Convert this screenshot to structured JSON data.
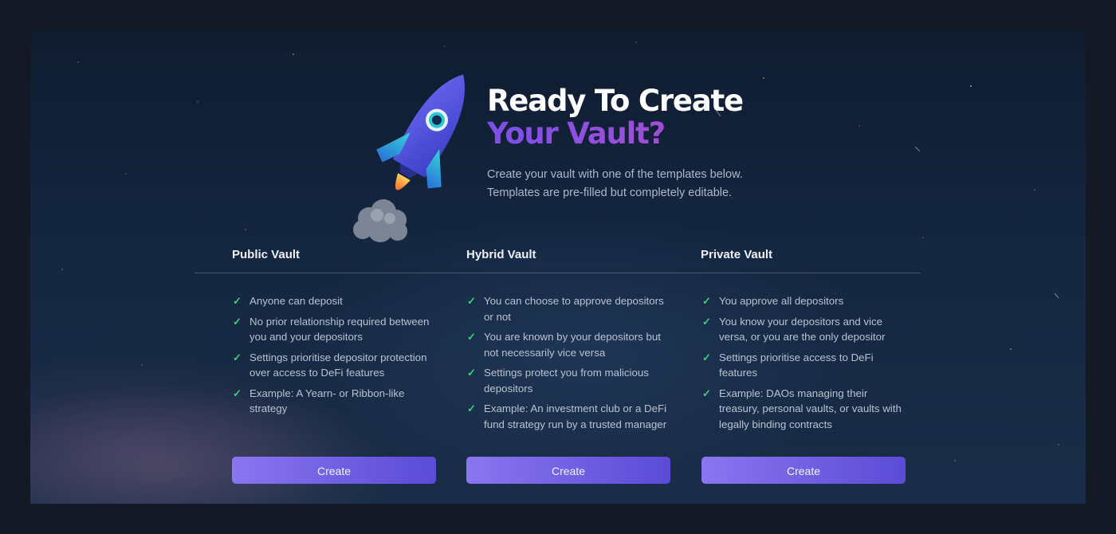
{
  "hero": {
    "title_line1": "Ready To Create",
    "title_line2": "Your Vault?",
    "subtitle_line1": "Create your vault with one of the templates below.",
    "subtitle_line2": "Templates are pre-filled but completely editable."
  },
  "icons": {
    "hero": "rocket-icon",
    "feature": "check-icon"
  },
  "colors": {
    "accent_purple": "#7b4fe8",
    "accent_pink": "#c34fc2",
    "check_green": "#3fd07a",
    "button_start": "#8a76f0",
    "button_end": "#5b4bd6"
  },
  "templates": [
    {
      "name": "Public Vault",
      "features": [
        "Anyone can deposit",
        "No prior relationship required between you and your depositors",
        "Settings prioritise depositor protection over access to DeFi features",
        "Example: A Yearn- or Ribbon-like strategy"
      ],
      "button_label": "Create"
    },
    {
      "name": "Hybrid Vault",
      "features": [
        "You can choose to approve depositors or not",
        "You are known by your depositors but not necessarily vice versa",
        "Settings protect you from malicious depositors",
        "Example: An investment club or a DeFi fund strategy run by a trusted manager"
      ],
      "button_label": "Create"
    },
    {
      "name": "Private Vault",
      "features": [
        "You approve all depositors",
        "You know your depositors and vice versa, or you are the only depositor",
        "Settings prioritise access to DeFi features",
        "Example: DAOs managing their treasury, personal vaults, or vaults with legally binding contracts"
      ],
      "button_label": "Create"
    }
  ]
}
